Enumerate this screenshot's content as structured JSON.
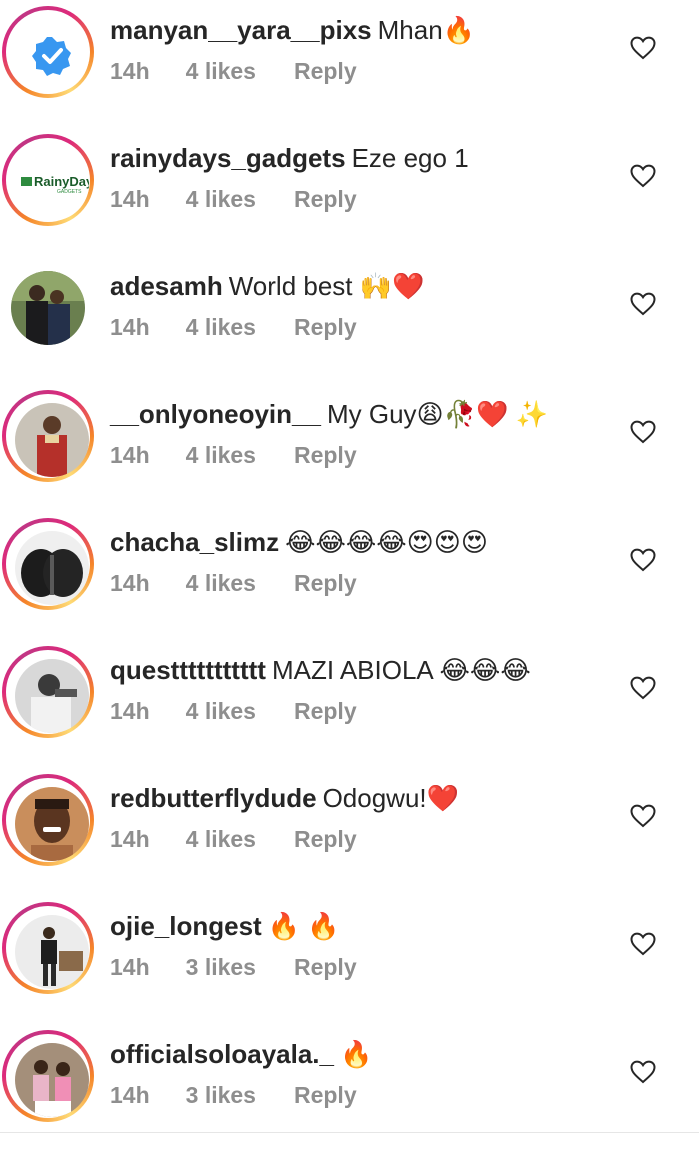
{
  "comments": [
    {
      "username": "manyan__yara__pixs",
      "text": "Mhan🔥",
      "time": "14h",
      "likes": "4 likes",
      "reply": "Reply",
      "avatar_icon": "verified-badge-icon",
      "ring": true
    },
    {
      "username": "rainydays_gadgets",
      "text": "Eze ego 1",
      "time": "14h",
      "likes": "4 likes",
      "reply": "Reply",
      "avatar_icon": "rainydays-logo",
      "ring": true,
      "logo_text": "RainyDays",
      "logo_sub": "GADGETS"
    },
    {
      "username": "adesamh",
      "text": "World best 🙌❤️",
      "time": "14h",
      "likes": "4 likes",
      "reply": "Reply",
      "avatar_icon": "photo-two-men",
      "ring": false
    },
    {
      "username": "__onlyoneoyin__",
      "text": "My Guy😩🥀❤️ ✨",
      "time": "14h",
      "likes": "4 likes",
      "reply": "Reply",
      "avatar_icon": "photo-man-red-outfit",
      "ring": true
    },
    {
      "username": "chacha_slimz",
      "text": "😂😂😂😂😍😍😍",
      "time": "14h",
      "likes": "4 likes",
      "reply": "Reply",
      "avatar_icon": "photo-dark-shape",
      "ring": true
    },
    {
      "username": "questtttttttttt",
      "text": "MAZI ABIOLA 😂😂😂",
      "time": "14h",
      "likes": "4 likes",
      "reply": "Reply",
      "avatar_icon": "photo-bw-man",
      "ring": true
    },
    {
      "username": "redbutterflydude",
      "text": "Odogwu!❤️",
      "time": "14h",
      "likes": "4 likes",
      "reply": "Reply",
      "avatar_icon": "photo-man-smiling",
      "ring": true
    },
    {
      "username": "ojie_longest",
      "text": "🔥 🔥",
      "time": "14h",
      "likes": "3 likes",
      "reply": "Reply",
      "avatar_icon": "photo-man-standing",
      "ring": true
    },
    {
      "username": "officialsoloayala._",
      "text": "🔥",
      "time": "14h",
      "likes": "3 likes",
      "reply": "Reply",
      "avatar_icon": "photo-family",
      "ring": true
    }
  ],
  "icons": {
    "like": "heart-outline-icon"
  },
  "colors": {
    "text": "#262626",
    "meta": "#8e8e8e",
    "verified": "#3897f0",
    "ring_start": "#f58529",
    "ring_end": "#c13584"
  }
}
